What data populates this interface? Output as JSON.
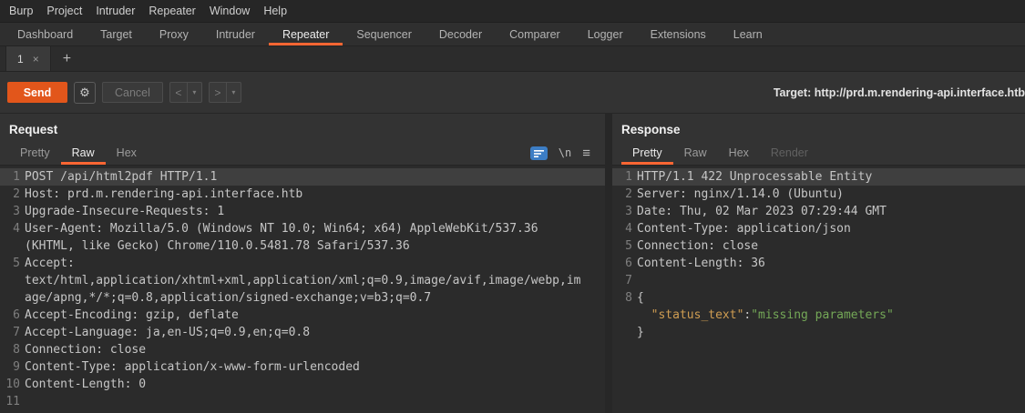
{
  "colors": {
    "accent": "#ff6633",
    "send_button": "#e2561b",
    "json_key": "#cf9d52",
    "json_string": "#74a857"
  },
  "menubar": [
    "Burp",
    "Project",
    "Intruder",
    "Repeater",
    "Window",
    "Help"
  ],
  "nav_tabs": [
    {
      "label": "Dashboard"
    },
    {
      "label": "Target"
    },
    {
      "label": "Proxy"
    },
    {
      "label": "Intruder"
    },
    {
      "label": "Repeater",
      "active": true
    },
    {
      "label": "Sequencer"
    },
    {
      "label": "Decoder"
    },
    {
      "label": "Comparer"
    },
    {
      "label": "Logger"
    },
    {
      "label": "Extensions"
    },
    {
      "label": "Learn"
    }
  ],
  "doc_tabs": {
    "tabs": [
      {
        "label": "1",
        "close": "×",
        "active": true
      }
    ],
    "add_label": "+"
  },
  "toolbar": {
    "send": "Send",
    "gear": "⚙",
    "cancel": "Cancel",
    "back": "<",
    "forward": ">",
    "caret": "▾",
    "target_label": "Target:",
    "target_url": "http://prd.m.rendering-api.interface.htb"
  },
  "request": {
    "title": "Request",
    "tabs": [
      {
        "label": "Pretty"
      },
      {
        "label": "Raw",
        "active": true
      },
      {
        "label": "Hex"
      }
    ],
    "icons": {
      "wrap": "word-wrap-toggle",
      "newline": "\\n",
      "menu": "≡"
    },
    "lines": [
      {
        "num": "1",
        "hl": true,
        "parts": [
          {
            "t": "POST /api/html2pdf HTTP/1.1"
          }
        ]
      },
      {
        "num": "2",
        "parts": [
          {
            "t": "Host: prd.m.rendering-api.interface.htb"
          }
        ]
      },
      {
        "num": "3",
        "parts": [
          {
            "t": "Upgrade-Insecure-Requests: 1"
          }
        ]
      },
      {
        "num": "4",
        "parts": [
          {
            "t": "User-Agent: Mozilla/5.0 (Windows NT 10.0; Win64; x64) AppleWebKit/537.36 (KHTML, like Gecko) Chrome/110.0.5481.78 Safari/537.36"
          }
        ]
      },
      {
        "num": "5",
        "parts": [
          {
            "t": "Accept: text/html,application/xhtml+xml,application/xml;q=0.9,image/avif,image/webp,image/apng,*/*;q=0.8,application/signed-exchange;v=b3;q=0.7"
          }
        ]
      },
      {
        "num": "6",
        "parts": [
          {
            "t": "Accept-Encoding: gzip, deflate"
          }
        ]
      },
      {
        "num": "7",
        "parts": [
          {
            "t": "Accept-Language: ja,en-US;q=0.9,en;q=0.8"
          }
        ]
      },
      {
        "num": "8",
        "parts": [
          {
            "t": "Connection: close"
          }
        ]
      },
      {
        "num": "9",
        "parts": [
          {
            "t": "Content-Type: application/x-www-form-urlencoded"
          }
        ]
      },
      {
        "num": "10",
        "parts": [
          {
            "t": "Content-Length: 0"
          }
        ]
      },
      {
        "num": "11",
        "parts": [
          {
            "t": ""
          }
        ]
      }
    ]
  },
  "response": {
    "title": "Response",
    "tabs": [
      {
        "label": "Pretty",
        "active": true
      },
      {
        "label": "Raw"
      },
      {
        "label": "Hex"
      },
      {
        "label": "Render",
        "dim": true
      }
    ],
    "lines": [
      {
        "num": "1",
        "hl": true,
        "parts": [
          {
            "t": "HTTP/1.1 422 Unprocessable Entity"
          }
        ]
      },
      {
        "num": "2",
        "parts": [
          {
            "t": "Server: nginx/1.14.0 (Ubuntu)"
          }
        ]
      },
      {
        "num": "3",
        "parts": [
          {
            "t": "Date: Thu, 02 Mar 2023 07:29:44 GMT"
          }
        ]
      },
      {
        "num": "4",
        "parts": [
          {
            "t": "Content-Type: application/json"
          }
        ]
      },
      {
        "num": "5",
        "parts": [
          {
            "t": "Connection: close"
          }
        ]
      },
      {
        "num": "6",
        "parts": [
          {
            "t": "Content-Length: 36"
          }
        ]
      },
      {
        "num": "7",
        "parts": [
          {
            "t": ""
          }
        ]
      },
      {
        "num": "8",
        "parts": [
          {
            "t": "{\n  "
          },
          {
            "t": "\"status_text\"",
            "c": "key"
          },
          {
            "t": ":"
          },
          {
            "t": "\"missing parameters\"",
            "c": "str"
          },
          {
            "t": "\n}"
          }
        ]
      }
    ]
  }
}
